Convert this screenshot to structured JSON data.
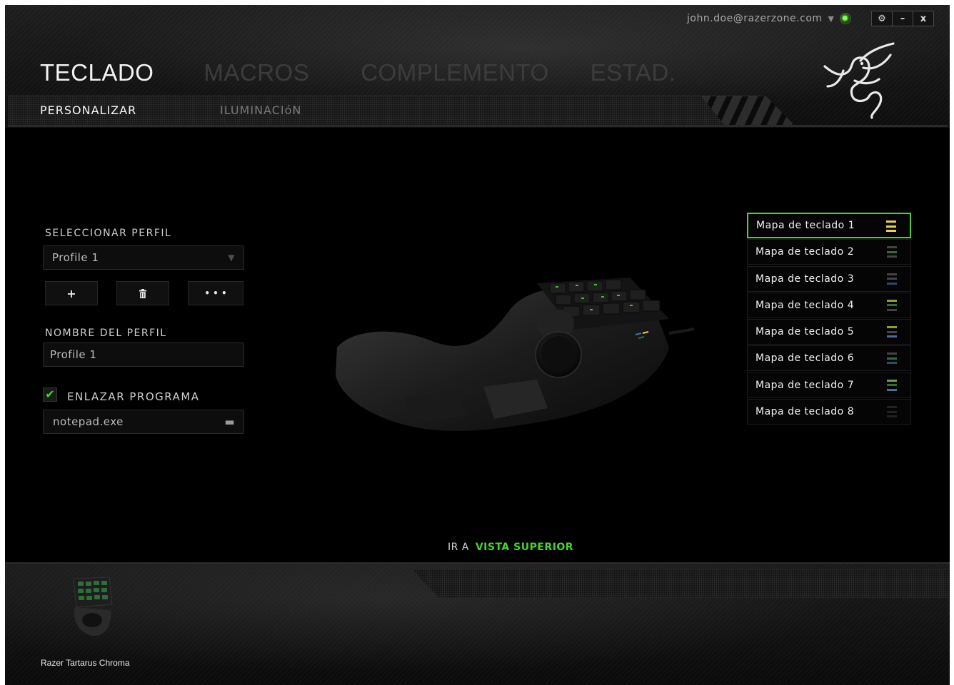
{
  "topbar": {
    "user_email": "john.doe@razerzone.com",
    "dropdown_icon": "chevron-down-icon",
    "status_icon": "online-status-icon",
    "window_buttons": [
      "⚙",
      "–",
      "x"
    ]
  },
  "main_tabs": [
    {
      "label": "TECLADO",
      "active": true
    },
    {
      "label": "MACROS",
      "active": false
    },
    {
      "label": "COMPLEMENTO",
      "active": false
    },
    {
      "label": "ESTAD.",
      "active": false
    }
  ],
  "sub_tabs": [
    {
      "label": "PERSONALIZAR",
      "active": true
    },
    {
      "label": "ILUMINACIóN",
      "active": false
    }
  ],
  "profile": {
    "select_label": "SELECCIONAR PERFIL",
    "selected": "Profile 1",
    "add_label": "+",
    "delete_icon": "trash-icon",
    "more_label": "• • •",
    "name_label": "NOMBRE DEL PERFIL",
    "name_value": "Profile 1",
    "link_label": "ENLAZAR PROGRAMA",
    "link_checked": true,
    "program": "notepad.exe"
  },
  "keymaps": {
    "active_index": 0,
    "items": [
      {
        "label": "Mapa de teclado 1",
        "color": "#e8d24a"
      },
      {
        "label": "Mapa de teclado 2",
        "color": "#2f6e3a"
      },
      {
        "label": "Mapa de teclado 3",
        "color": "#2a4a6e"
      },
      {
        "label": "Mapa de teclado 4",
        "color": "#8aa13a"
      },
      {
        "label": "Mapa de teclado 5",
        "color": "#4a6aa0"
      },
      {
        "label": "Mapa de teclado 6",
        "color": "#2f6a5a"
      },
      {
        "label": "Mapa de teclado 7",
        "color": "#6aa04a"
      },
      {
        "label": "Mapa de teclado 8",
        "color": "#2a2a2a"
      }
    ]
  },
  "view_link": {
    "prefix": "IR A",
    "label": "VISTA SUPERIOR"
  },
  "footer": {
    "device_name": "Razer Tartarus Chroma"
  },
  "colors": {
    "accent": "#44d62c",
    "background": "#000000"
  }
}
